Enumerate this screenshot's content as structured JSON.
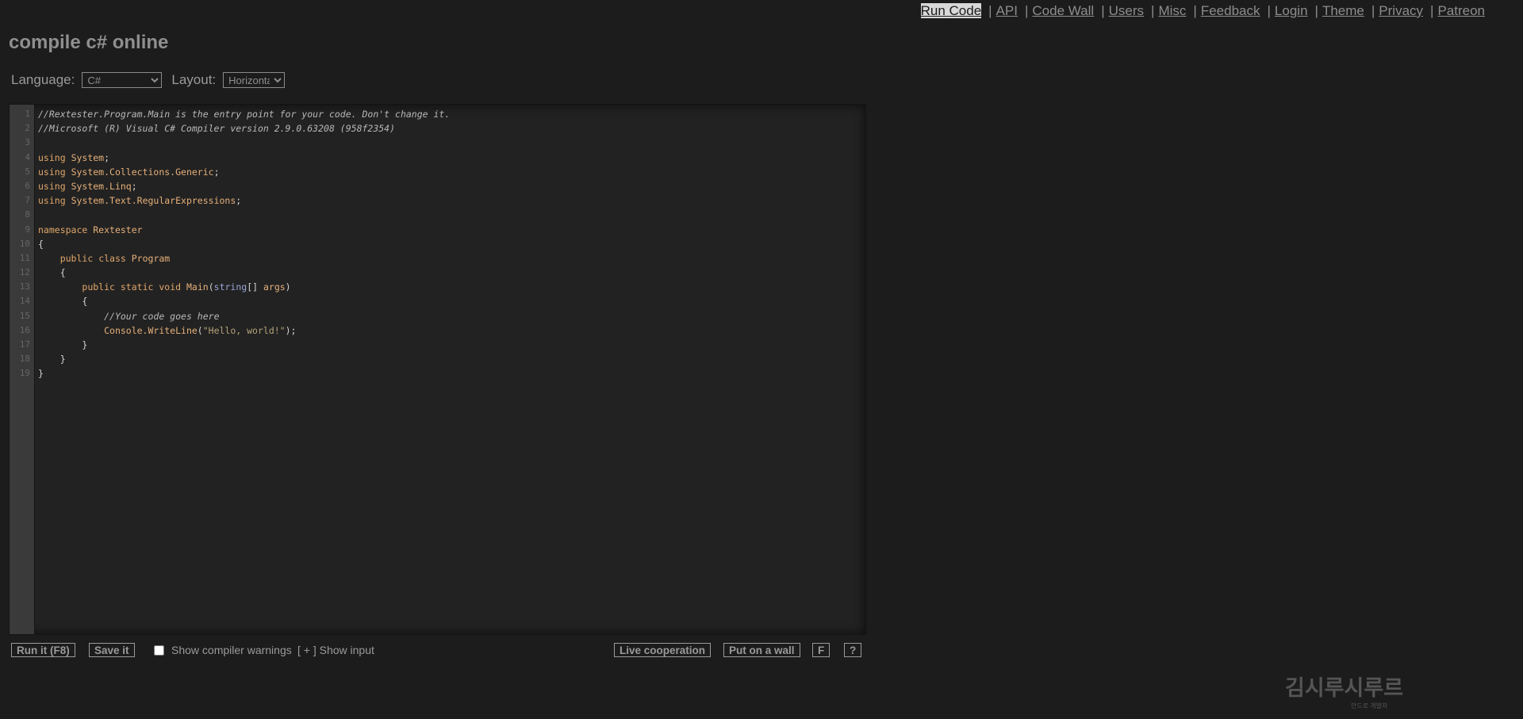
{
  "nav": {
    "links": [
      "Run Code",
      "API",
      "Code Wall",
      "Users",
      "Misc",
      "Feedback",
      "Login",
      "Theme",
      "Privacy",
      "Patreon"
    ],
    "separator": "|"
  },
  "page": {
    "title": "compile c# online"
  },
  "options": {
    "language_label": "Language:",
    "language_value": "C#",
    "layout_label": "Layout:",
    "layout_value": "Horizontal"
  },
  "editor": {
    "line_numbers": [
      "1",
      "2",
      "3",
      "4",
      "5",
      "6",
      "7",
      "8",
      "9",
      "10",
      "11",
      "12",
      "13",
      "14",
      "15",
      "16",
      "17",
      "18",
      "19"
    ],
    "lines": [
      "//Rextester.Program.Main is the entry point for your code. Don't change it.",
      "//Microsoft (R) Visual C# Compiler version 2.9.0.63208 (958f2354)",
      "",
      "using System;",
      "using System.Collections.Generic;",
      "using System.Linq;",
      "using System.Text.RegularExpressions;",
      "",
      "namespace Rextester",
      "{",
      "    public class Program",
      "    {",
      "        public static void Main(string[] args)",
      "        {",
      "            //Your code goes here",
      "            Console.WriteLine(\"Hello, world!\");",
      "        }",
      "    }",
      "}"
    ]
  },
  "bottombar": {
    "run_label": "Run it (F8)",
    "save_label": "Save it",
    "warnings_label": "Show compiler warnings",
    "show_input_label": "[ + ] Show input",
    "live_label": "Live cooperation",
    "wall_label": "Put on a wall",
    "f_label": "F",
    "help_label": "?"
  },
  "watermark": {
    "title": "김시루시루르",
    "subtitle": "안드로 개발자"
  }
}
